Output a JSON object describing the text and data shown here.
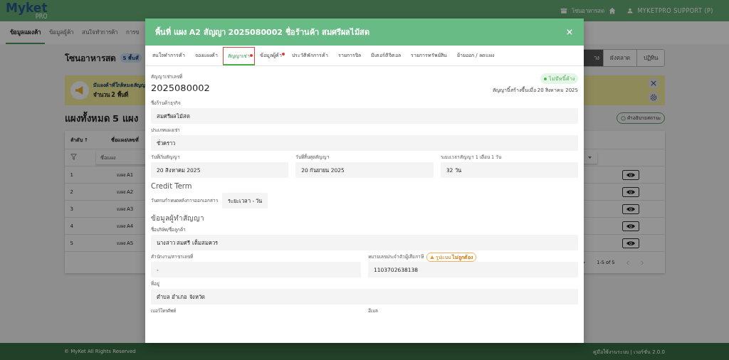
{
  "header": {
    "logo": "Myket",
    "logo_sub": "PRO",
    "zone": "โซนอาหารสด",
    "user": "MYKETPRO SUPPORT (P)"
  },
  "nav_tabs": [
    {
      "label": "ข้อมูลแผงค้า",
      "selected": true
    },
    {
      "label": "ข้อมูลผู้ค้า",
      "selected": false
    },
    {
      "label": "สนใจทำการค้า",
      "selected": false
    },
    {
      "label": "การข",
      "selected": false
    }
  ],
  "zone_title": "โซนอาหารสด",
  "zone_badge": "5 พื้นที่",
  "view_buttons": [
    {
      "label": "าง",
      "selected": true
    },
    {
      "label": "ผังตลาด",
      "selected": false
    },
    {
      "label": "ปฏิทิน",
      "selected": false
    }
  ],
  "banner": {
    "title": "มีแผงค้าที่ใกล้หมดสัญญ",
    "count": "จำนวน 2 พื้นที่"
  },
  "stall_summary": "แผงทั้งหมด 5 แผง",
  "status_help": "คำอธิบายสถานะ",
  "table": {
    "columns": [
      "ลำดับ ↑",
      "ชื่อแผง/เลขที่"
    ],
    "filter_placeholder": "ชื่อแผง",
    "rows": [
      {
        "no": "1",
        "name": "แผง A1"
      },
      {
        "no": "2",
        "name": "แผง A2"
      },
      {
        "no": "3",
        "name": "แผง A3"
      },
      {
        "no": "4",
        "name": "แผง A4"
      },
      {
        "no": "5",
        "name": "แผง A5"
      }
    ],
    "pagination": "1-5 of 5"
  },
  "modal": {
    "title": "พื้นที่ แผง A2 สัญญา 2025080002 ชื่อร้านค้า สมศรีผลไม้สด",
    "tabs": [
      {
        "label": "สนใจทำการค้า",
        "selected": false,
        "alert": false
      },
      {
        "label": "จองแผงค้า",
        "selected": false,
        "alert": false
      },
      {
        "label": "สัญญาเช่า",
        "selected": true,
        "alert": true
      },
      {
        "label": "ข้อมูลผู้ค้า",
        "selected": false,
        "alert": true
      },
      {
        "label": "ประวัติพักการค้า",
        "selected": false,
        "alert": false
      },
      {
        "label": "รายการบิล",
        "selected": false,
        "alert": false
      },
      {
        "label": "มิเตอร์ดิจิตอล",
        "selected": false,
        "alert": false
      },
      {
        "label": "รายการทรัพย์สิน",
        "selected": false,
        "alert": false
      },
      {
        "label": "ย้ายออก / ลดแผง",
        "selected": false,
        "alert": false
      }
    ],
    "contract_label": "สัญญาเช่าเลขที่",
    "contract_no": "2025080002",
    "status": "ไม่มีหนี้ค้าง",
    "created": "สัญญานี้สร้างขึ้นเมื่อ 20 สิงหาคม 2025",
    "sections": [
      {
        "kind": "fields",
        "fields": [
          {
            "label": "ชื่อร้านค้าธุรกิจ",
            "value": "สมศรีผลไม้สด"
          }
        ]
      },
      {
        "kind": "fields",
        "fields": [
          {
            "label": "ประเภทแผงเช่า",
            "value": "ชั่วคราว"
          }
        ]
      },
      {
        "kind": "fields",
        "fields": [
          {
            "label": "วันที่เริ่มสัญญา",
            "value": "20 สิงหาคม 2025"
          },
          {
            "label": "วันที่สิ้นสุดสัญญา",
            "value": "20 กันยายน 2025"
          },
          {
            "label": "ระยะเวลาสัญญา 1 เดือน 1 วัน",
            "value": "32 วัน"
          }
        ]
      },
      {
        "kind": "heading",
        "text": "Credit Term"
      },
      {
        "kind": "inline",
        "label": "วันครบกำหนดหลังการออกเอกสาร",
        "value": "ระยะเวลา - วัน"
      },
      {
        "kind": "heading",
        "text": "ข้อมูลผู้ทำสัญญา"
      },
      {
        "kind": "fields",
        "fields": [
          {
            "label": "ชื่อบริษัท/ชื่อลูกค้า",
            "value": "นางสาว สมศรี เต็มสมควร"
          }
        ]
      },
      {
        "kind": "fields",
        "fields": [
          {
            "label": "สำนักงาน/สาขาเลขที่",
            "value": "-"
          },
          {
            "label": "หมายเลขประจำตัวผู้เสียภาษี",
            "value": "1103702638138",
            "warning": "รูปแบบ **ไม่ถูกต้อง**"
          }
        ]
      },
      {
        "kind": "fields",
        "fields": [
          {
            "label": "ที่อยู่",
            "value": "ตำบล อำเภอ จังหวัด"
          }
        ]
      },
      {
        "kind": "labels",
        "fields": [
          {
            "label": "เบอร์โทรศัพท์"
          },
          {
            "label": "อีเมล"
          }
        ]
      }
    ]
  },
  "footer": {
    "copyright": "© MyKet All Rights Reserved",
    "links": "คู่มือใช้งานระบบ | เวอร์ชั่น 2.0.0"
  }
}
